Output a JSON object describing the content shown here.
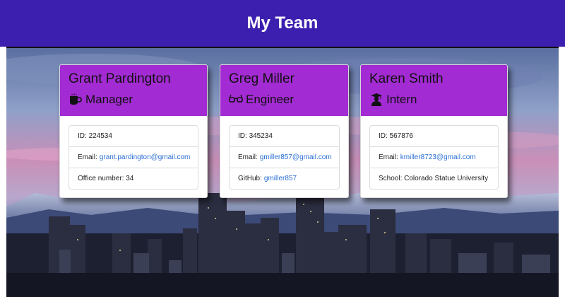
{
  "header": {
    "title": "My Team"
  },
  "colors": {
    "navbar": "#3d1fb0",
    "card_header": "#a32bd3",
    "link": "#2a6fd6"
  },
  "cards": [
    {
      "name": "Grant Pardington",
      "role": "Manager",
      "role_icon": "coffee-icon",
      "id_label": "ID:",
      "id_value": "224534",
      "email_label": "Email:",
      "email_value": "grant.pardington@gmail.com",
      "extra_label": "Office number:",
      "extra_value": "34"
    },
    {
      "name": "Greg Miller",
      "role": "Engineer",
      "role_icon": "glasses-icon",
      "id_label": "ID:",
      "id_value": "345234",
      "email_label": "Email:",
      "email_value": "gmiller857@gmail.com",
      "extra_label": "GitHub:",
      "extra_value": "gmiller857"
    },
    {
      "name": "Karen Smith",
      "role": "Intern",
      "role_icon": "graduate-icon",
      "id_label": "ID:",
      "id_value": "567876",
      "email_label": "Email:",
      "email_value": "kmiller8723@gmail.com",
      "extra_label": "School:",
      "extra_value": "Colorado Statue University"
    }
  ]
}
